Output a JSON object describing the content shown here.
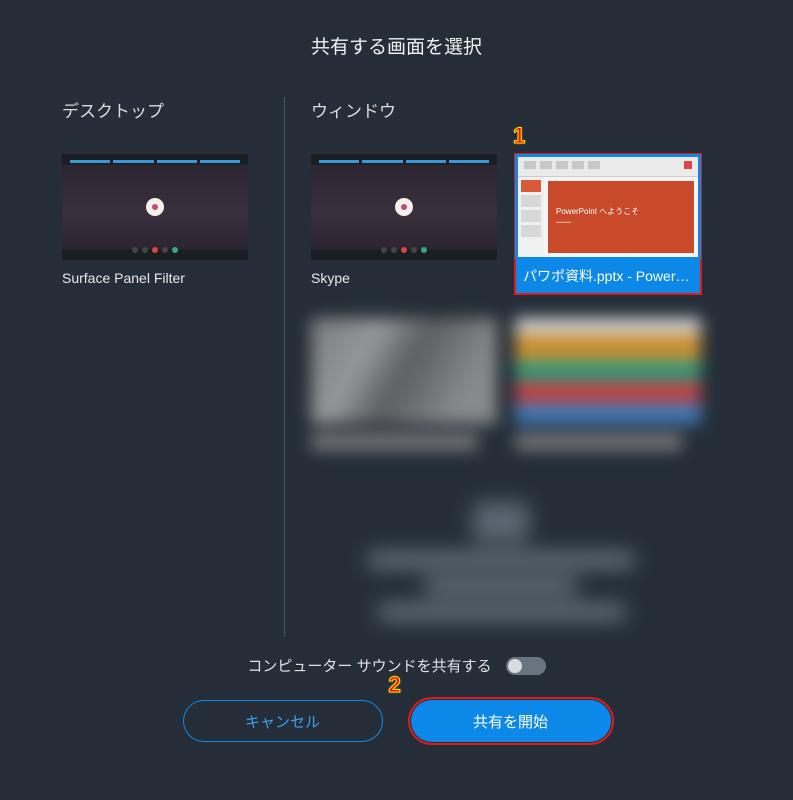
{
  "dialog": {
    "title": "共有する画面を選択"
  },
  "sections": {
    "desktop_header": "デスクトップ",
    "window_header": "ウィンドウ"
  },
  "desktop_items": [
    {
      "label": "Surface Panel Filter"
    }
  ],
  "window_items": [
    {
      "label": "Skype",
      "selected": false
    },
    {
      "label": "パワポ資料.pptx - PowerP...",
      "selected": true,
      "ppt_title": "PowerPoint へようこそ"
    }
  ],
  "footer": {
    "sound_label": "コンピューター サウンドを共有する",
    "sound_on": false,
    "cancel_label": "キャンセル",
    "start_label": "共有を開始"
  },
  "callouts": {
    "c1": "1",
    "c2": "2"
  },
  "colors": {
    "accent": "#0c88e8",
    "highlight_border": "#e01a1a"
  }
}
